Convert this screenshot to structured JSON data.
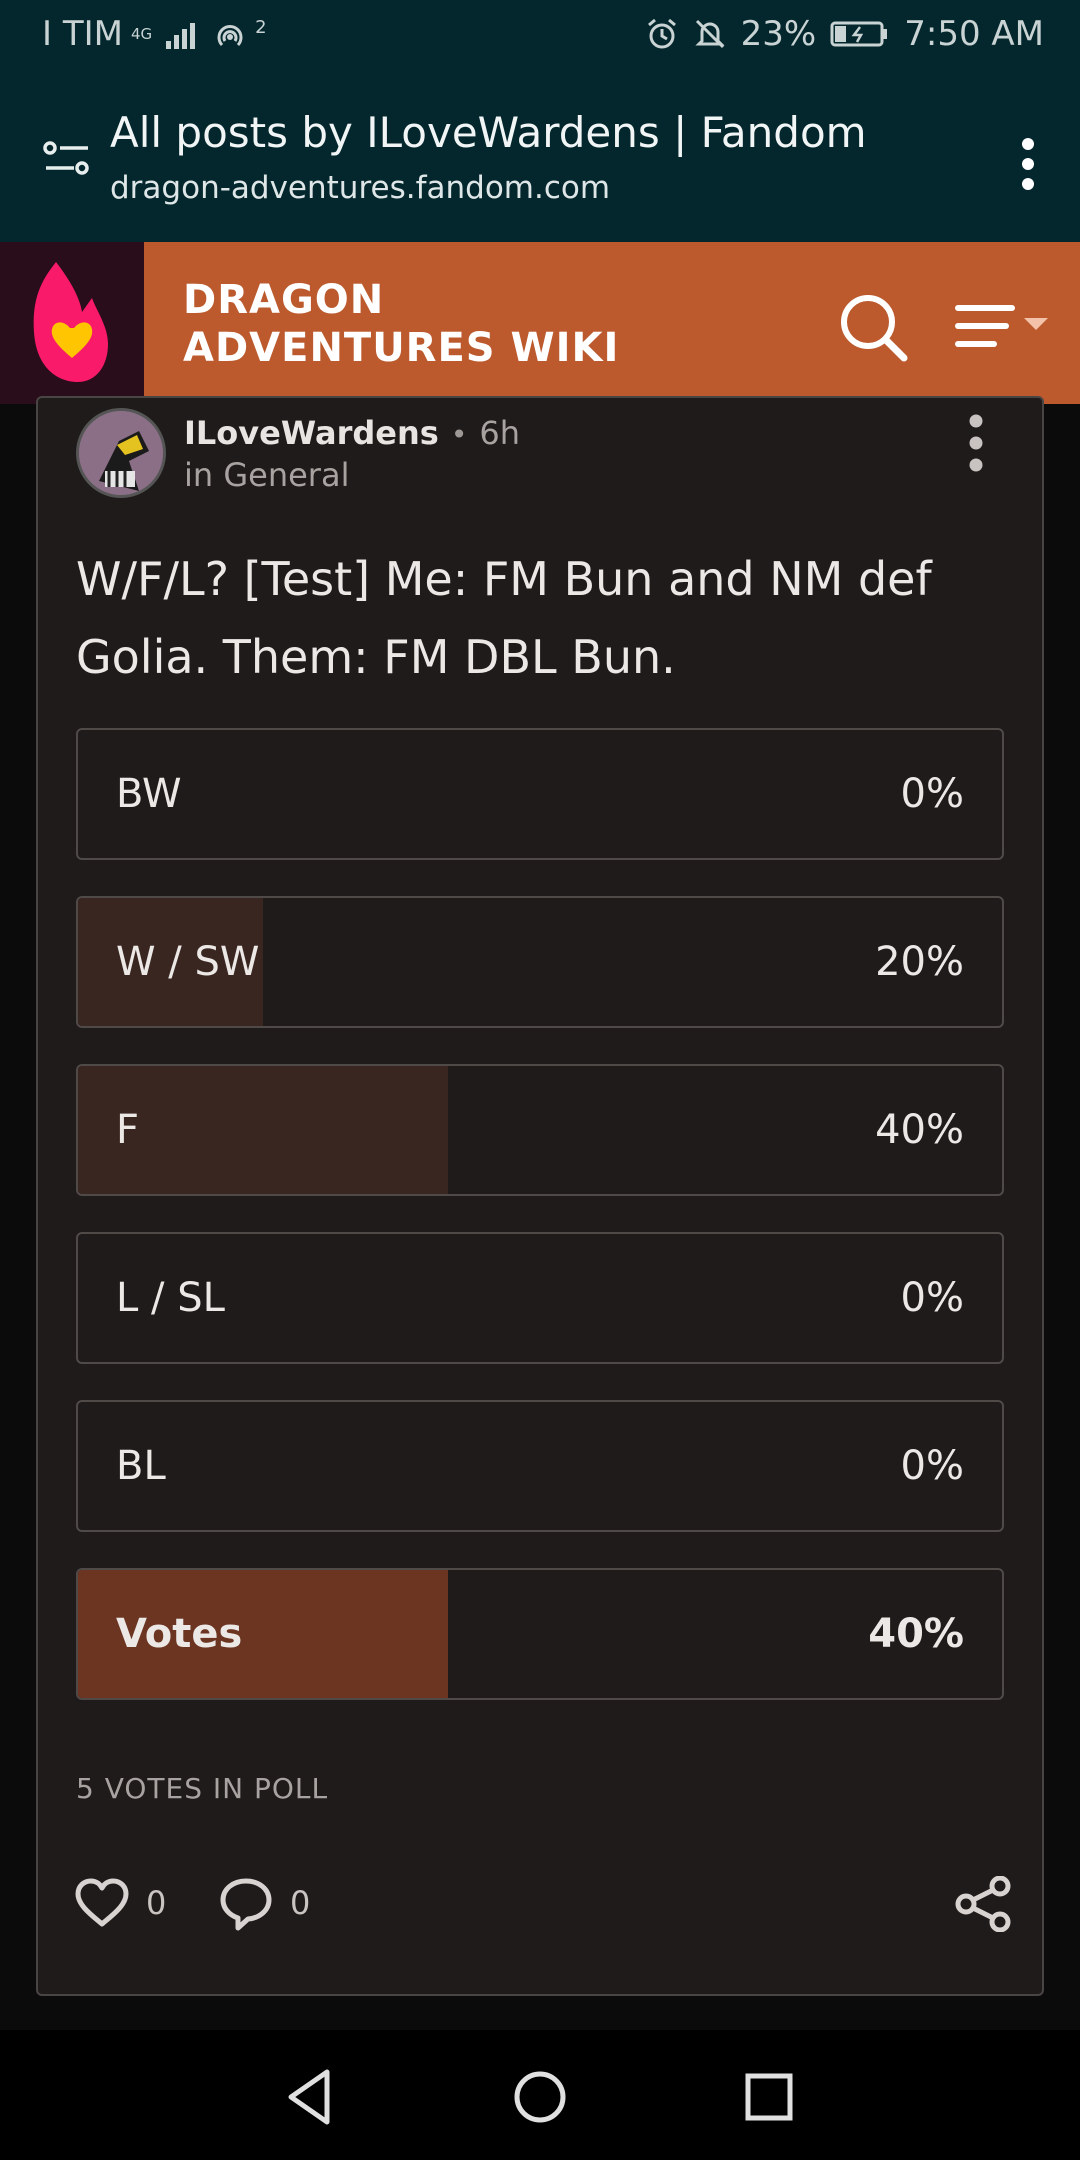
{
  "status_bar": {
    "carrier": "I TIM",
    "network_type": "4G",
    "hotspot_count": "2",
    "battery": "23%",
    "time": "7:50 AM"
  },
  "browser": {
    "page_title": "All posts by ILoveWardens | Fandom",
    "url": "dragon-adventures.fandom.com",
    "menu_icon": "kebab-vertical-icon",
    "tune_icon": "page-info-icon"
  },
  "wiki_header": {
    "name_line1": "DRAGON",
    "name_line2": "ADVENTURES WIKI",
    "logo": "fandom-flame-heart-logo",
    "brand_color": "#bc5a2e"
  },
  "post": {
    "author": "ILoveWardens",
    "time_ago": "6h",
    "category": "in General",
    "title": "W/F/L? [Test] Me: FM Bun and NM def Golia. Them: FM DBL Bun.",
    "poll": {
      "options": [
        {
          "label": "BW",
          "percent": "0%",
          "fraction": 0
        },
        {
          "label": "W / SW",
          "percent": "20%",
          "fraction": 0.2
        },
        {
          "label": "F",
          "percent": "40%",
          "fraction": 0.4
        },
        {
          "label": "L / SL",
          "percent": "0%",
          "fraction": 0
        },
        {
          "label": "BL",
          "percent": "0%",
          "fraction": 0
        },
        {
          "label": "Votes",
          "percent": "40%",
          "fraction": 0.4,
          "selected": true
        }
      ],
      "total_votes_text": "5 VOTES IN POLL"
    },
    "likes": "0",
    "comments": "0"
  },
  "colors": {
    "status_bg": "#03272d",
    "card_bg": "#1f1b1b",
    "poll_fill": "#3a2621",
    "poll_fill_selected": "#6b3522"
  }
}
